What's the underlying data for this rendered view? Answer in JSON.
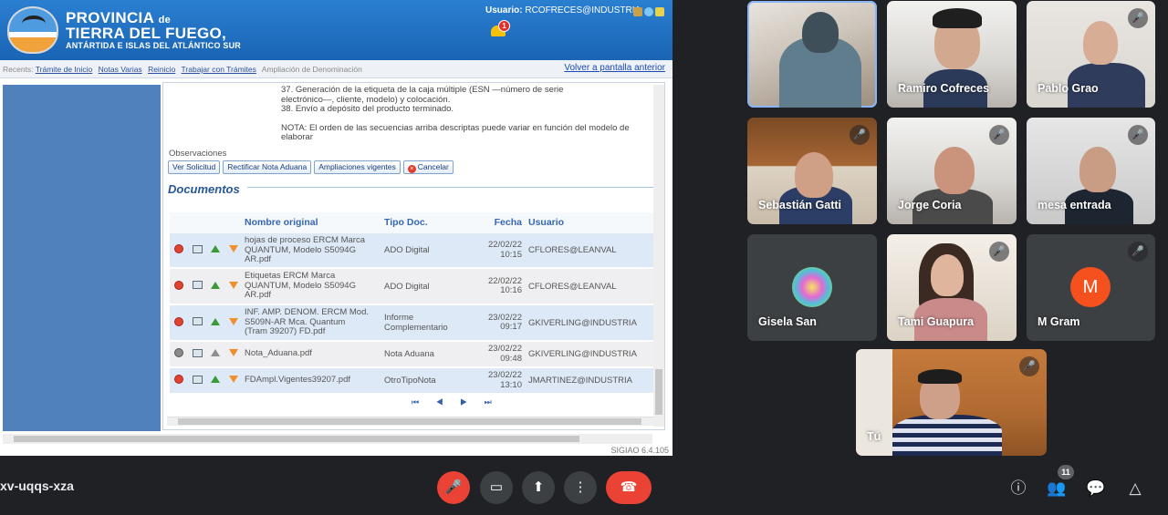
{
  "app": {
    "province_line1": "PROVINCIA",
    "province_de": "de",
    "province_line2": "TIERRA DEL FUEGO,",
    "province_line3": "ANTÁRTIDA E ISLAS DEL ATLÁNTICO SUR",
    "user_label": "Usuario:",
    "user_value": "RCOFRECES@INDUSTRIA",
    "notifications": "1",
    "version": "SIGIAO 6.4.105"
  },
  "nav": {
    "recent_label": "Recents:",
    "links": [
      "Trámite de Inicio",
      "Notas Varias",
      "Reinicio",
      "Trabajar con Trámites"
    ],
    "current": "Ampliación de Denominación",
    "back": "Volver a pantalla anterior"
  },
  "content": {
    "step37a": "37. Generación de la etiqueta de la caja múltiple (ESN —número de serie",
    "step37b": "electrónico—, cliente, modelo) y colocación.",
    "step38": "38. Envío a depósito del producto terminado.",
    "notaA": "NOTA: El orden de las secuencias arriba descriptas puede variar en función del modelo de",
    "notaB": "elaborar",
    "observaciones": "Observaciones",
    "buttons": {
      "ver": "Ver Solicitud",
      "rectificar": "Rectificar Nota Aduana",
      "ampliaciones": "Ampliaciones vigentes",
      "cancelar": "Cancelar"
    },
    "documentos_title": "Documentos"
  },
  "table": {
    "headers": {
      "nombre": "Nombre original",
      "tipo": "Tipo Doc.",
      "fecha": "Fecha",
      "usuario": "Usuario"
    },
    "rows": [
      {
        "n1": "hojas de proceso ERCM Marca",
        "n2": "QUANTUM, Modelo S5094G",
        "n3": "AR.pdf",
        "tipo1": "ADO Digital",
        "tipo2": "",
        "date": "22/02/22",
        "time": "10:15",
        "usuario": "CFLORES@LEANVAL"
      },
      {
        "n1": "Etiquetas ERCM Marca",
        "n2": "QUANTUM, Modelo S5094G",
        "n3": "AR.pdf",
        "tipo1": "ADO Digital",
        "tipo2": "",
        "date": "22/02/22",
        "time": "10:16",
        "usuario": "CFLORES@LEANVAL"
      },
      {
        "n1": "INF. AMP. DENOM. ERCM Mod.",
        "n2": "S509N-AR Mca. Quantum",
        "n3": "(Tram 39207) FD.pdf",
        "tipo1": "Informe",
        "tipo2": "Complementario",
        "date": "23/02/22",
        "time": "09:17",
        "usuario": "GKIVERLING@INDUSTRIA"
      },
      {
        "n1": "Nota_Aduana.pdf",
        "n2": "",
        "n3": "",
        "tipo1": "Nota Aduana",
        "tipo2": "",
        "date": "23/02/22",
        "time": "09:48",
        "usuario": "GKIVERLING@INDUSTRIA"
      },
      {
        "n1": "FDAmpl.Vigentes39207.pdf",
        "n2": "",
        "n3": "",
        "tipo1": "OtroTipoNota",
        "tipo2": "",
        "date": "23/02/22",
        "time": "13:10",
        "usuario": "JMARTINEZ@INDUSTRIA"
      }
    ],
    "pager": "⏮ ◀ ▶ ⏭"
  },
  "participants": [
    {
      "name": "",
      "muted": false
    },
    {
      "name": "Ramiro Cofreces",
      "muted": false
    },
    {
      "name": "Pablo Grao",
      "muted": true
    },
    {
      "name": "Sebastián Gatti",
      "muted": true
    },
    {
      "name": "Jorge Coria",
      "muted": true
    },
    {
      "name": "mesa entrada",
      "muted": true
    },
    {
      "name": "Gisela San",
      "muted": false
    },
    {
      "name": "Tami Guapura",
      "muted": true
    },
    {
      "name": "M Gram",
      "muted": true,
      "initial": "M"
    },
    {
      "name": "Tú",
      "muted": true
    }
  ],
  "meeting": {
    "code": "xv-uqqs-xza",
    "participant_count": "11"
  },
  "icons": {
    "mic_off": "🎤",
    "camera": "▭",
    "present": "⬆",
    "more": "⋮",
    "end_call": "☎",
    "info": "ⓘ",
    "people": "👥",
    "chat": "💬",
    "activities": "△"
  },
  "colors": {
    "header_blue": "#1e6fc0",
    "meet_red": "#ea4335",
    "avatar_orange": "#f4511e"
  }
}
